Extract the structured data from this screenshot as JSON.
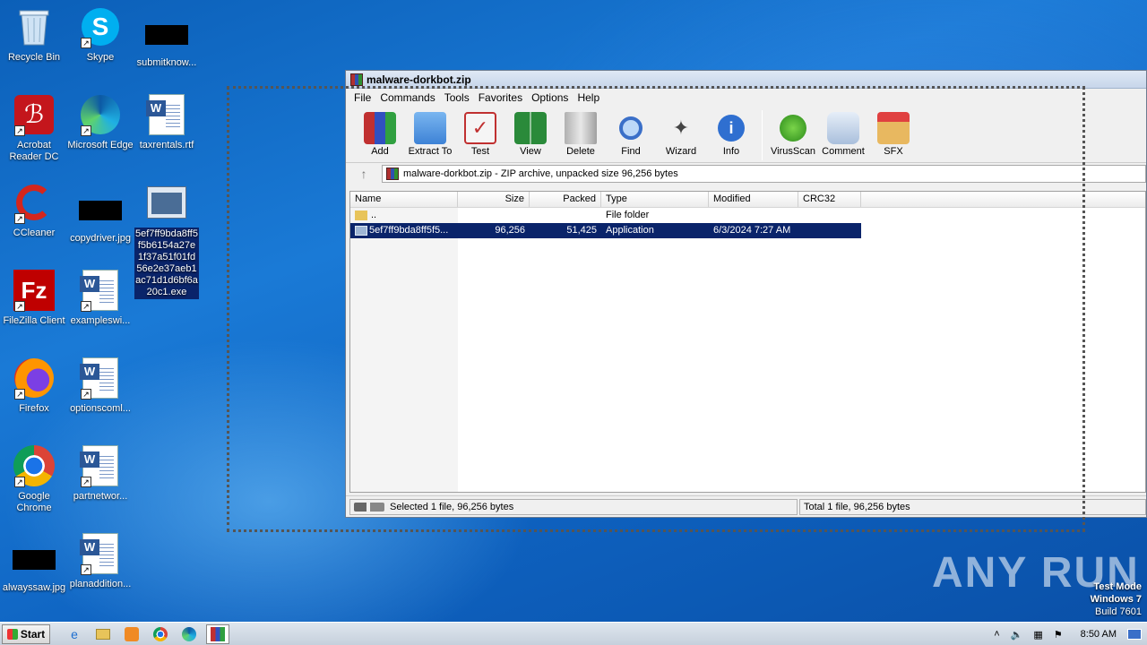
{
  "desktop": {
    "icons": [
      {
        "label": "Recycle Bin"
      },
      {
        "label": "Skype"
      },
      {
        "label": "submitknow..."
      },
      {
        "label": "Acrobat Reader DC"
      },
      {
        "label": "Microsoft Edge"
      },
      {
        "label": "taxrentals.rtf"
      },
      {
        "label": "CCleaner"
      },
      {
        "label": "copydriver.jpg"
      },
      {
        "label": "5ef7ff9bda8ff5f5b6154a27e1f37a51f01fd56e2e37aeb1ac71d1d6bf6a20c1.exe"
      },
      {
        "label": "FileZilla Client"
      },
      {
        "label": "exampleswi..."
      },
      {
        "label": "Firefox"
      },
      {
        "label": "optionscoml..."
      },
      {
        "label": "Google Chrome"
      },
      {
        "label": "partnetwor..."
      },
      {
        "label": "alwayssaw.jpg"
      },
      {
        "label": "planaddition..."
      }
    ]
  },
  "window": {
    "title": "malware-dorkbot.zip",
    "menu": [
      "File",
      "Commands",
      "Tools",
      "Favorites",
      "Options",
      "Help"
    ],
    "toolbar": [
      "Add",
      "Extract To",
      "Test",
      "View",
      "Delete",
      "Find",
      "Wizard",
      "Info",
      "VirusScan",
      "Comment",
      "SFX"
    ],
    "address": "malware-dorkbot.zip - ZIP archive, unpacked size 96,256 bytes",
    "columns": [
      "Name",
      "Size",
      "Packed",
      "Type",
      "Modified",
      "CRC32"
    ],
    "rows": [
      {
        "name": "..",
        "size": "",
        "packed": "",
        "type": "File folder",
        "modified": ""
      },
      {
        "name": "5ef7ff9bda8ff5f5...",
        "size": "96,256",
        "packed": "51,425",
        "type": "Application",
        "modified": "6/3/2024 7:27 AM"
      }
    ],
    "status_left": "Selected 1 file, 96,256 bytes",
    "status_right": "Total 1 file, 96,256 bytes"
  },
  "watermark": "ANY RUN",
  "testmode": {
    "line1": "Test Mode",
    "line2": "Windows 7",
    "line3": "Build 7601"
  },
  "taskbar": {
    "start": "Start",
    "clock": "8:50 AM"
  }
}
